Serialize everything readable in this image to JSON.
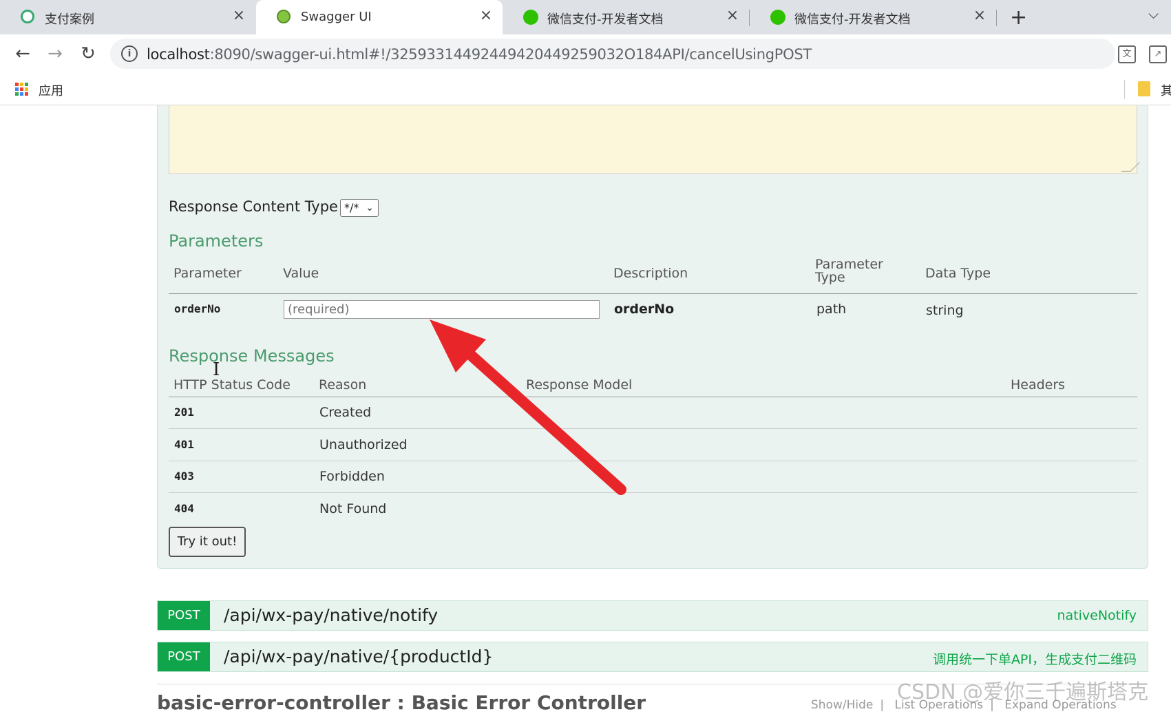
{
  "browser": {
    "tabs": [
      {
        "title": "支付案例",
        "icon": "payment-case-favicon",
        "active": false
      },
      {
        "title": "Swagger UI",
        "icon": "swagger-favicon",
        "active": true
      },
      {
        "title": "微信支付-开发者文档",
        "icon": "wechat-favicon",
        "active": false
      },
      {
        "title": "微信支付-开发者文档",
        "icon": "wechat-favicon",
        "active": false
      }
    ],
    "close_glyph": "×",
    "new_tab_glyph": "+",
    "tab_menu_glyph": "⌵",
    "url_host": "localhost",
    "url_rest": ":8090/swagger-ui.html#!/32593314492449420449259032O184API/cancelUsingPOST",
    "bookmarks": {
      "apps_label": "应用",
      "other_label": "其"
    }
  },
  "operation": {
    "response_content_type_label": "Response Content Type",
    "response_content_type_value": "*/*",
    "parameters": {
      "title": "Parameters",
      "headers": {
        "parameter": "Parameter",
        "value": "Value",
        "description": "Description",
        "parameter_type_line1": "Parameter",
        "parameter_type_line2": "Type",
        "data_type": "Data Type"
      },
      "rows": [
        {
          "parameter": "orderNo",
          "placeholder": "(required)",
          "description": "orderNo",
          "parameter_type": "path",
          "data_type": "string"
        }
      ]
    },
    "response_messages": {
      "title": "Response Messages",
      "headers": {
        "status": "HTTP Status Code",
        "reason": "Reason",
        "model": "Response Model",
        "headers": "Headers"
      },
      "rows": [
        {
          "code": "201",
          "reason": "Created"
        },
        {
          "code": "401",
          "reason": "Unauthorized"
        },
        {
          "code": "403",
          "reason": "Forbidden"
        },
        {
          "code": "404",
          "reason": "Not Found"
        }
      ]
    },
    "try_button": "Try it out!"
  },
  "endpoints": [
    {
      "method": "POST",
      "path": "/api/wx-pay/native/notify",
      "summary": "nativeNotify"
    },
    {
      "method": "POST",
      "path": "/api/wx-pay/native/{productId}",
      "summary": "调用统一下单API，生成支付二维码"
    }
  ],
  "next_controller": {
    "heading": "basic-error-controller : Basic Error Controller",
    "links": [
      "Show/Hide",
      "List Operations",
      "Expand Operations"
    ]
  },
  "watermark": "CSDN @爱你三千遍斯塔克",
  "colors": {
    "accent_green": "#10a54a",
    "section_green": "#4a9b6e",
    "annotation_arrow": "#e8262a",
    "body_yellow": "#fcf6db"
  }
}
